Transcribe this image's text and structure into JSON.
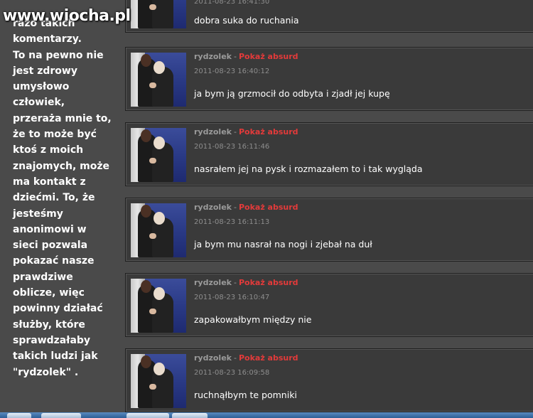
{
  "watermark": "www.wiocha.pl",
  "side_text": "razo takich\nkomentarzy.\nTo na pewno nie\njest zdrowy\numysłowo\nczłowiek,\nprzeraża mnie to,\nże to może być\nktoś z moich\nznajomych, może\nma kontakt z\ndziećmi. To, że\njesteśmy\nanonimowi w\nsieci pozwala\npokazać nasze\nprawdziwe\noblicze, więc\npowinny działać\nsłużby, które\nsprawdzałaby\ntakich ludzi jak\n\"rydzolek\" .",
  "comments": [
    {
      "user": "",
      "sep": "",
      "action": "",
      "time": "2011-08-23 16:41:30",
      "text": "dobra suka do ruchania"
    },
    {
      "user": "rydzolek",
      "sep": "-",
      "action": "Pokaż absurd",
      "time": "2011-08-23 16:40:12",
      "text": "ja bym ją grzmocił do odbyta i zjadł jej kupę"
    },
    {
      "user": "rydzolek",
      "sep": "-",
      "action": "Pokaż absurd",
      "time": "2011-08-23 16:11:46",
      "text": "nasrałem jej na pysk i rozmazałem to i tak wygląda"
    },
    {
      "user": "rydzolek",
      "sep": "-",
      "action": "Pokaż absurd",
      "time": "2011-08-23 16:11:13",
      "text": "ja bym mu nasrał na nogi i zjebał na duł"
    },
    {
      "user": "rydzolek",
      "sep": "-",
      "action": "Pokaż absurd",
      "time": "2011-08-23 16:10:47",
      "text": "zapakowałbym między nie"
    },
    {
      "user": "rydzolek",
      "sep": "-",
      "action": "Pokaż absurd",
      "time": "2011-08-23 16:09:58",
      "text": "ruchnąłbym te pomniki"
    }
  ],
  "colors": {
    "absurd_link": "#e33a3a",
    "username": "#9a9a9a",
    "panel": "#3a3a3a",
    "page": "#4a4a4a"
  }
}
